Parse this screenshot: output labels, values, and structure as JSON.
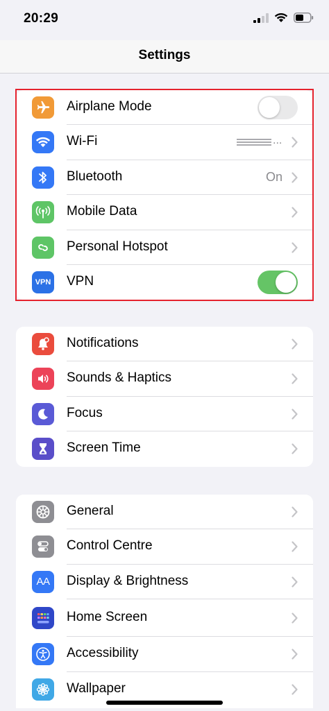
{
  "status_bar": {
    "time": "20:29"
  },
  "nav": {
    "title": "Settings"
  },
  "groups": [
    {
      "items": [
        {
          "label": "Airplane Mode",
          "icon": "airplane-icon",
          "color": "#f19a37",
          "control": "toggle",
          "toggle_on": false
        },
        {
          "label": "Wi-Fi",
          "icon": "wifi-icon",
          "color": "#3478f6",
          "control": "value-chevron",
          "value": "..."
        },
        {
          "label": "Bluetooth",
          "icon": "bluetooth-icon",
          "color": "#3478f6",
          "control": "value-chevron",
          "value": "On"
        },
        {
          "label": "Mobile Data",
          "icon": "antenna-icon",
          "color": "#5ec566",
          "control": "chevron"
        },
        {
          "label": "Personal Hotspot",
          "icon": "hotspot-link-icon",
          "color": "#5ec566",
          "control": "chevron"
        },
        {
          "label": "VPN",
          "icon": "vpn-icon",
          "icon_text": "VPN",
          "color": "#2b71e6",
          "control": "toggle",
          "toggle_on": true
        }
      ]
    },
    {
      "items": [
        {
          "label": "Notifications",
          "icon": "bell-icon",
          "color": "#ea4c3d",
          "control": "chevron"
        },
        {
          "label": "Sounds & Haptics",
          "icon": "speaker-icon",
          "color": "#ec4358",
          "control": "chevron"
        },
        {
          "label": "Focus",
          "icon": "moon-icon",
          "color": "#5a5ad6",
          "control": "chevron"
        },
        {
          "label": "Screen Time",
          "icon": "hourglass-icon",
          "color": "#5a4ec9",
          "control": "chevron"
        }
      ]
    },
    {
      "items": [
        {
          "label": "General",
          "icon": "gear-icon",
          "color": "#8e8e93",
          "control": "chevron"
        },
        {
          "label": "Control Centre",
          "icon": "switches-icon",
          "color": "#8e8e93",
          "control": "chevron"
        },
        {
          "label": "Display & Brightness",
          "icon": "text-size-icon",
          "icon_text": "AA",
          "color": "#3478f6",
          "control": "chevron"
        },
        {
          "label": "Home Screen",
          "icon": "app-grid-icon",
          "color": "#2f47c8",
          "control": "chevron"
        },
        {
          "label": "Accessibility",
          "icon": "accessibility-icon",
          "color": "#3478f6",
          "control": "chevron"
        },
        {
          "label": "Wallpaper",
          "icon": "flower-icon",
          "color": "#40a8e6",
          "control": "chevron"
        }
      ]
    }
  ]
}
